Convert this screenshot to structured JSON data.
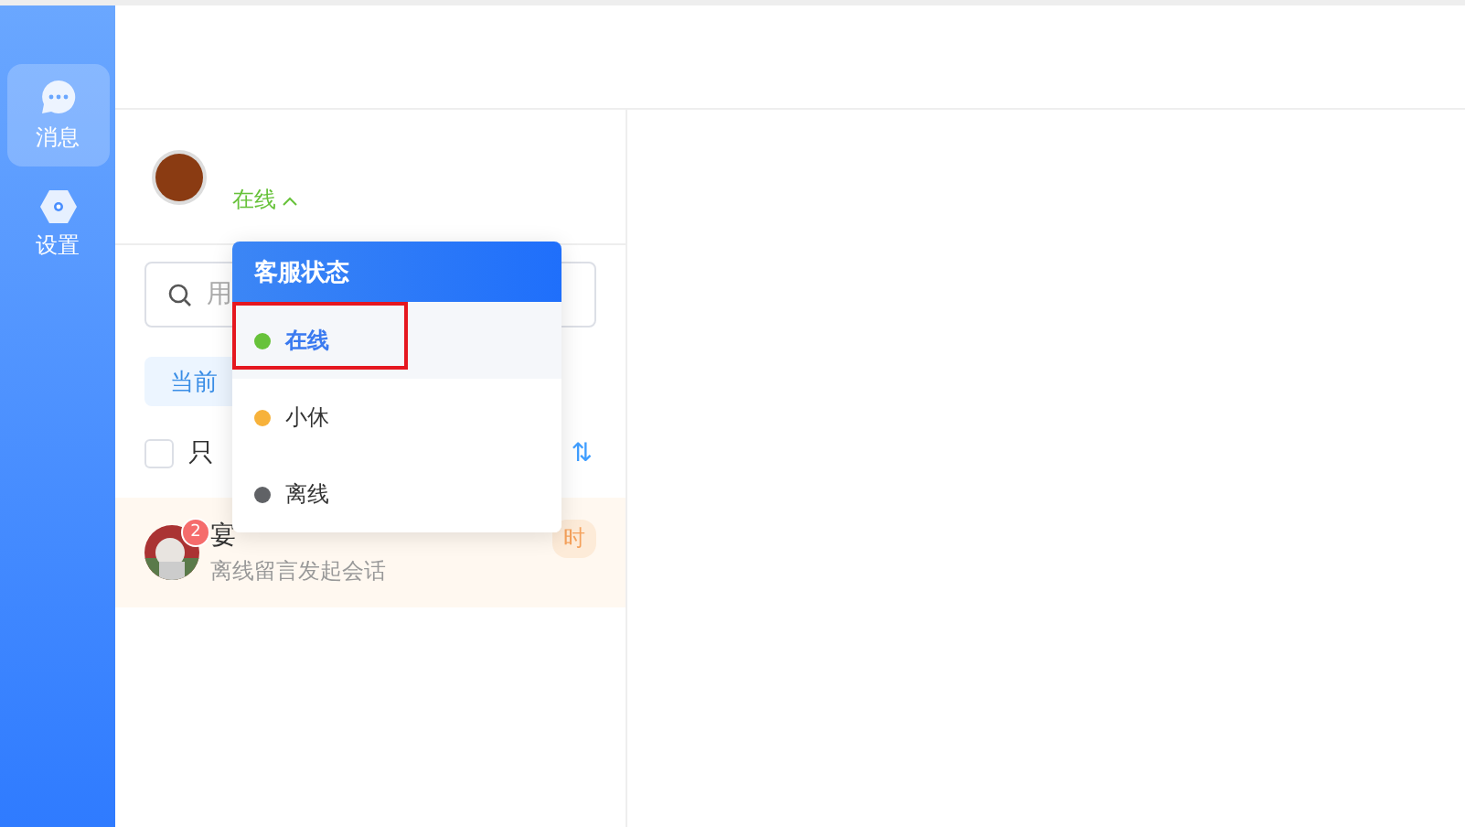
{
  "nav": [
    {
      "label": "消息",
      "selected": true
    },
    {
      "label": "设置",
      "selected": false
    }
  ],
  "agent": {
    "status": "在线",
    "expanded": true
  },
  "search": {
    "placeholder": "用"
  },
  "tab": {
    "label": "当前"
  },
  "filter": {
    "label": "只",
    "checked": false,
    "sort_icon": "⇅"
  },
  "conversations": [
    {
      "name": "宴",
      "preview": "离线留言发起会话",
      "badge": "2",
      "time": "时",
      "selected": true
    }
  ],
  "status_menu": {
    "title": "客服状态",
    "items": [
      {
        "label": "在线",
        "color": "#67c23a",
        "selected": true
      },
      {
        "label": "小休",
        "color": "#f7b23b",
        "selected": false
      },
      {
        "label": "离线",
        "color": "#606266",
        "selected": false
      }
    ]
  }
}
